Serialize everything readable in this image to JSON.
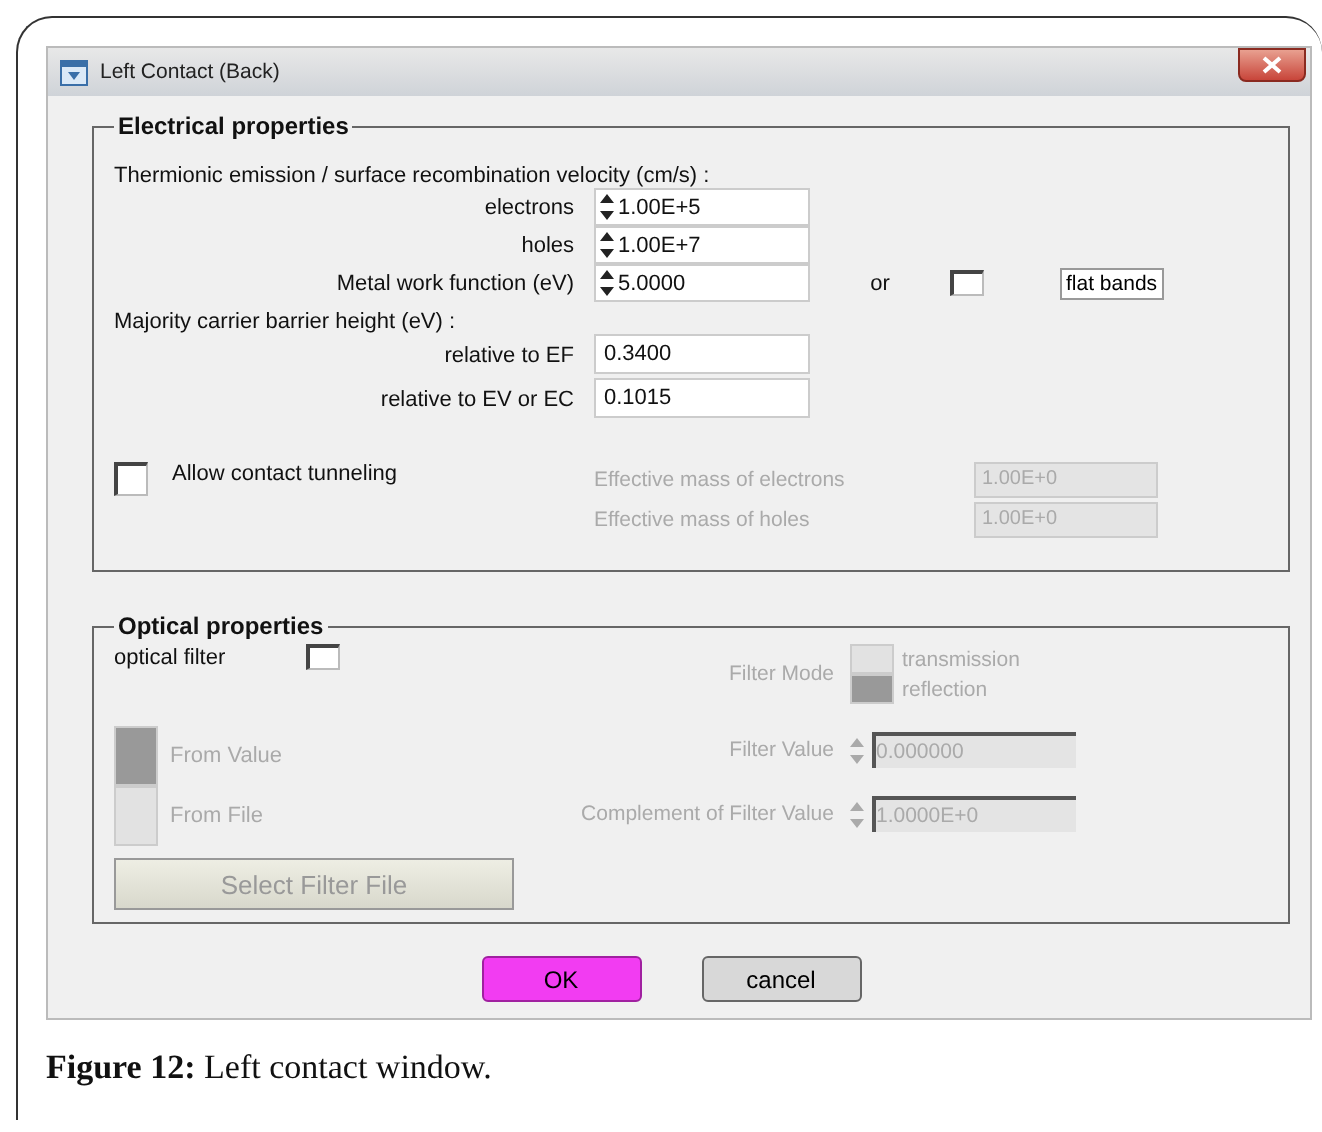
{
  "window": {
    "title": "Left Contact (Back)"
  },
  "electrical": {
    "legend": "Electrical properties",
    "velocity_label": "Thermionic emission / surface recombination velocity (cm/s) :",
    "velocity_fields": [
      {
        "label": "electrons",
        "value": "1.00E+5"
      },
      {
        "label": "holes",
        "value": "1.00E+7"
      },
      {
        "label": "Metal work function (eV)",
        "value": "5.0000"
      }
    ],
    "or_label": "or",
    "flat_bands_checked": false,
    "flat_bands_button": "flat bands",
    "barrier_label": "Majority carrier barrier height (eV) :",
    "barrier_fields": [
      {
        "label": "relative to EF",
        "value": "0.3400"
      },
      {
        "label": "relative to EV or EC",
        "value": "0.1015"
      }
    ],
    "tunneling": {
      "label": "Allow contact tunneling",
      "checked": false
    },
    "mass_fields": [
      {
        "label": "Effective mass of electrons",
        "value": "1.00E+0",
        "disabled": true
      },
      {
        "label": "Effective mass of holes",
        "value": "1.00E+0",
        "disabled": true
      }
    ]
  },
  "optical": {
    "legend": "Optical properties",
    "filter": {
      "label": "optical filter",
      "checked": false
    },
    "filter_mode_label": "Filter Mode",
    "modes": [
      {
        "label": "transmission",
        "selected": false,
        "disabled": true
      },
      {
        "label": "reflection",
        "selected": true,
        "disabled": true
      }
    ],
    "sources": [
      {
        "label": "From Value",
        "selected": true,
        "disabled": true
      },
      {
        "label": "From File",
        "selected": false,
        "disabled": true
      }
    ],
    "value_fields": [
      {
        "label": "Filter Value",
        "value": "0.000000",
        "disabled": true
      },
      {
        "label": "Complement of Filter Value",
        "value": "1.0000E+0",
        "disabled": true
      }
    ],
    "select_button": {
      "label": "Select Filter File",
      "disabled": true
    }
  },
  "buttons": [
    {
      "label": "OK",
      "kind": "primary"
    },
    {
      "label": "cancel",
      "kind": "normal"
    }
  ],
  "caption": "**Figure 12:** Left contact window."
}
